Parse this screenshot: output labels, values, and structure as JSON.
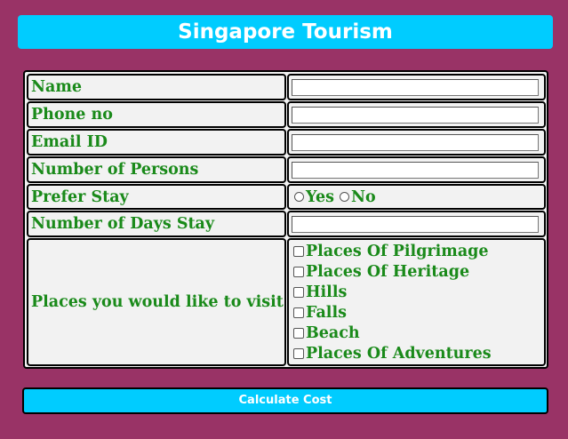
{
  "header": {
    "title": "Singapore Tourism"
  },
  "form": {
    "name_label": "Name",
    "name_value": "",
    "phone_label": "Phone no",
    "phone_value": "",
    "email_label": "Email ID",
    "email_value": "",
    "persons_label": "Number of Persons",
    "persons_value": "",
    "stay_label": "Prefer Stay",
    "stay_yes": "Yes",
    "stay_no": "No",
    "days_label": "Number of Days Stay",
    "days_value": "",
    "places_label": "Places you would like to visit",
    "places": [
      "Places Of Pilgrimage",
      "Places Of Heritage",
      "Hills",
      "Falls",
      "Beach",
      "Places Of Adventures"
    ]
  },
  "button": {
    "calculate_label": "Calculate Cost"
  },
  "colors": {
    "background": "#993366",
    "accent": "#00ccff",
    "label_text": "#1a8a1a",
    "cell_background": "#f2f2f2"
  }
}
